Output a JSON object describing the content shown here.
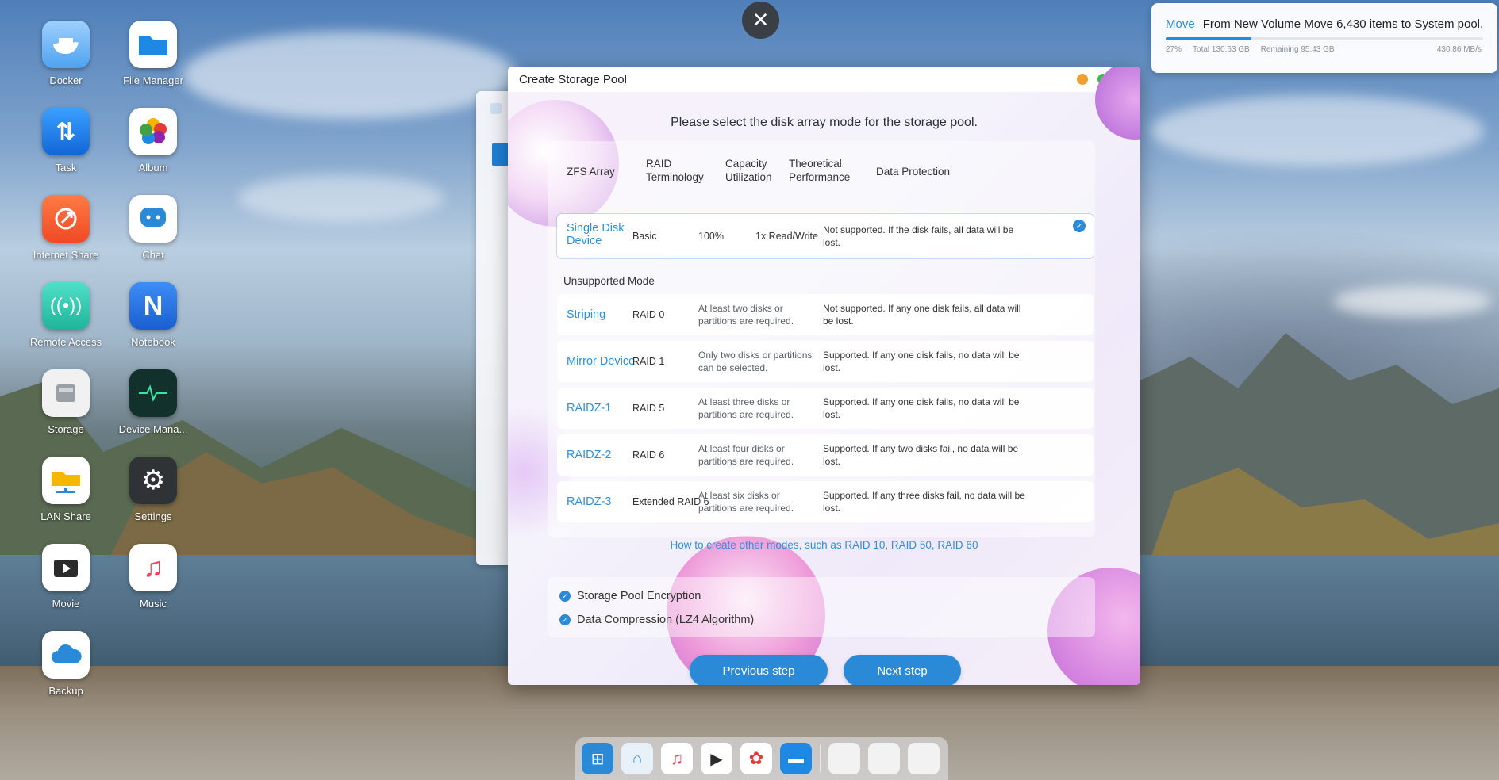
{
  "desktop": {
    "icons": [
      {
        "label": "Docker"
      },
      {
        "label": "File Manager"
      },
      {
        "label": "Task"
      },
      {
        "label": "Album"
      },
      {
        "label": "Internet Share"
      },
      {
        "label": "Chat"
      },
      {
        "label": "Remote Access"
      },
      {
        "label": "Notebook"
      },
      {
        "label": "Storage"
      },
      {
        "label": "Device Mana..."
      },
      {
        "label": "LAN Share"
      },
      {
        "label": "Settings"
      },
      {
        "label": "Movie"
      },
      {
        "label": "Music"
      },
      {
        "label": "Backup"
      }
    ]
  },
  "overlay_close": "✕",
  "notification": {
    "tag": "Move",
    "text": "From New Volume Move 6,430 items to System pool...",
    "progress_fraction": 0.27,
    "percent": "27%",
    "total": "Total 130.63 GB",
    "remaining": "Remaining 95.43 GB",
    "speed": "430.86 MB/s"
  },
  "dialog": {
    "title": "Create Storage Pool",
    "heading": "Please select the disk array mode for the storage pool.",
    "columns": {
      "zfs": "ZFS Array",
      "raid": "RAID Terminology",
      "capacity": "Capacity Utilization",
      "performance": "Theoretical Performance",
      "protection": "Data Protection"
    },
    "selected_row": {
      "name": "Single Disk Device",
      "raid": "Basic",
      "capacity": "100%",
      "performance": "1x Read/Write",
      "protection": "Not supported. If the disk fails, all data will be lost."
    },
    "section_label": "Unsupported Mode",
    "rows": [
      {
        "name": "Striping",
        "raid": "RAID 0",
        "requirement": "At least two disks or partitions are required.",
        "protection": "Not supported. If any one disk fails, all data will be lost."
      },
      {
        "name": "Mirror Device",
        "raid": "RAID 1",
        "requirement": "Only two disks or partitions can be selected.",
        "protection": "Supported. If any one disk fails, no data will be lost."
      },
      {
        "name": "RAIDZ-1",
        "raid": "RAID 5",
        "requirement": "At least three disks or partitions are required.",
        "protection": "Supported. If any one disk fails, no data will be lost."
      },
      {
        "name": "RAIDZ-2",
        "raid": "RAID 6",
        "requirement": "At least four disks or partitions are required.",
        "protection": "Supported. If any two disks fail, no data will be lost."
      },
      {
        "name": "RAIDZ-3",
        "raid": "Extended RAID 6",
        "requirement": "At least six disks or partitions are required.",
        "protection": "Supported. If any three disks fail, no data will be lost."
      }
    ],
    "help_link": "How to create other modes, such as RAID 10, RAID 50, RAID 60",
    "options": {
      "encryption": "Storage Pool Encryption",
      "compression": "Data Compression (LZ4 Algorithm)"
    },
    "buttons": {
      "previous": "Previous step",
      "next": "Next step"
    }
  },
  "colors": {
    "accent": "#2a8ad8",
    "close": "#e8453c",
    "minimize": "#f0a030",
    "maximize": "#3dbb4f"
  }
}
